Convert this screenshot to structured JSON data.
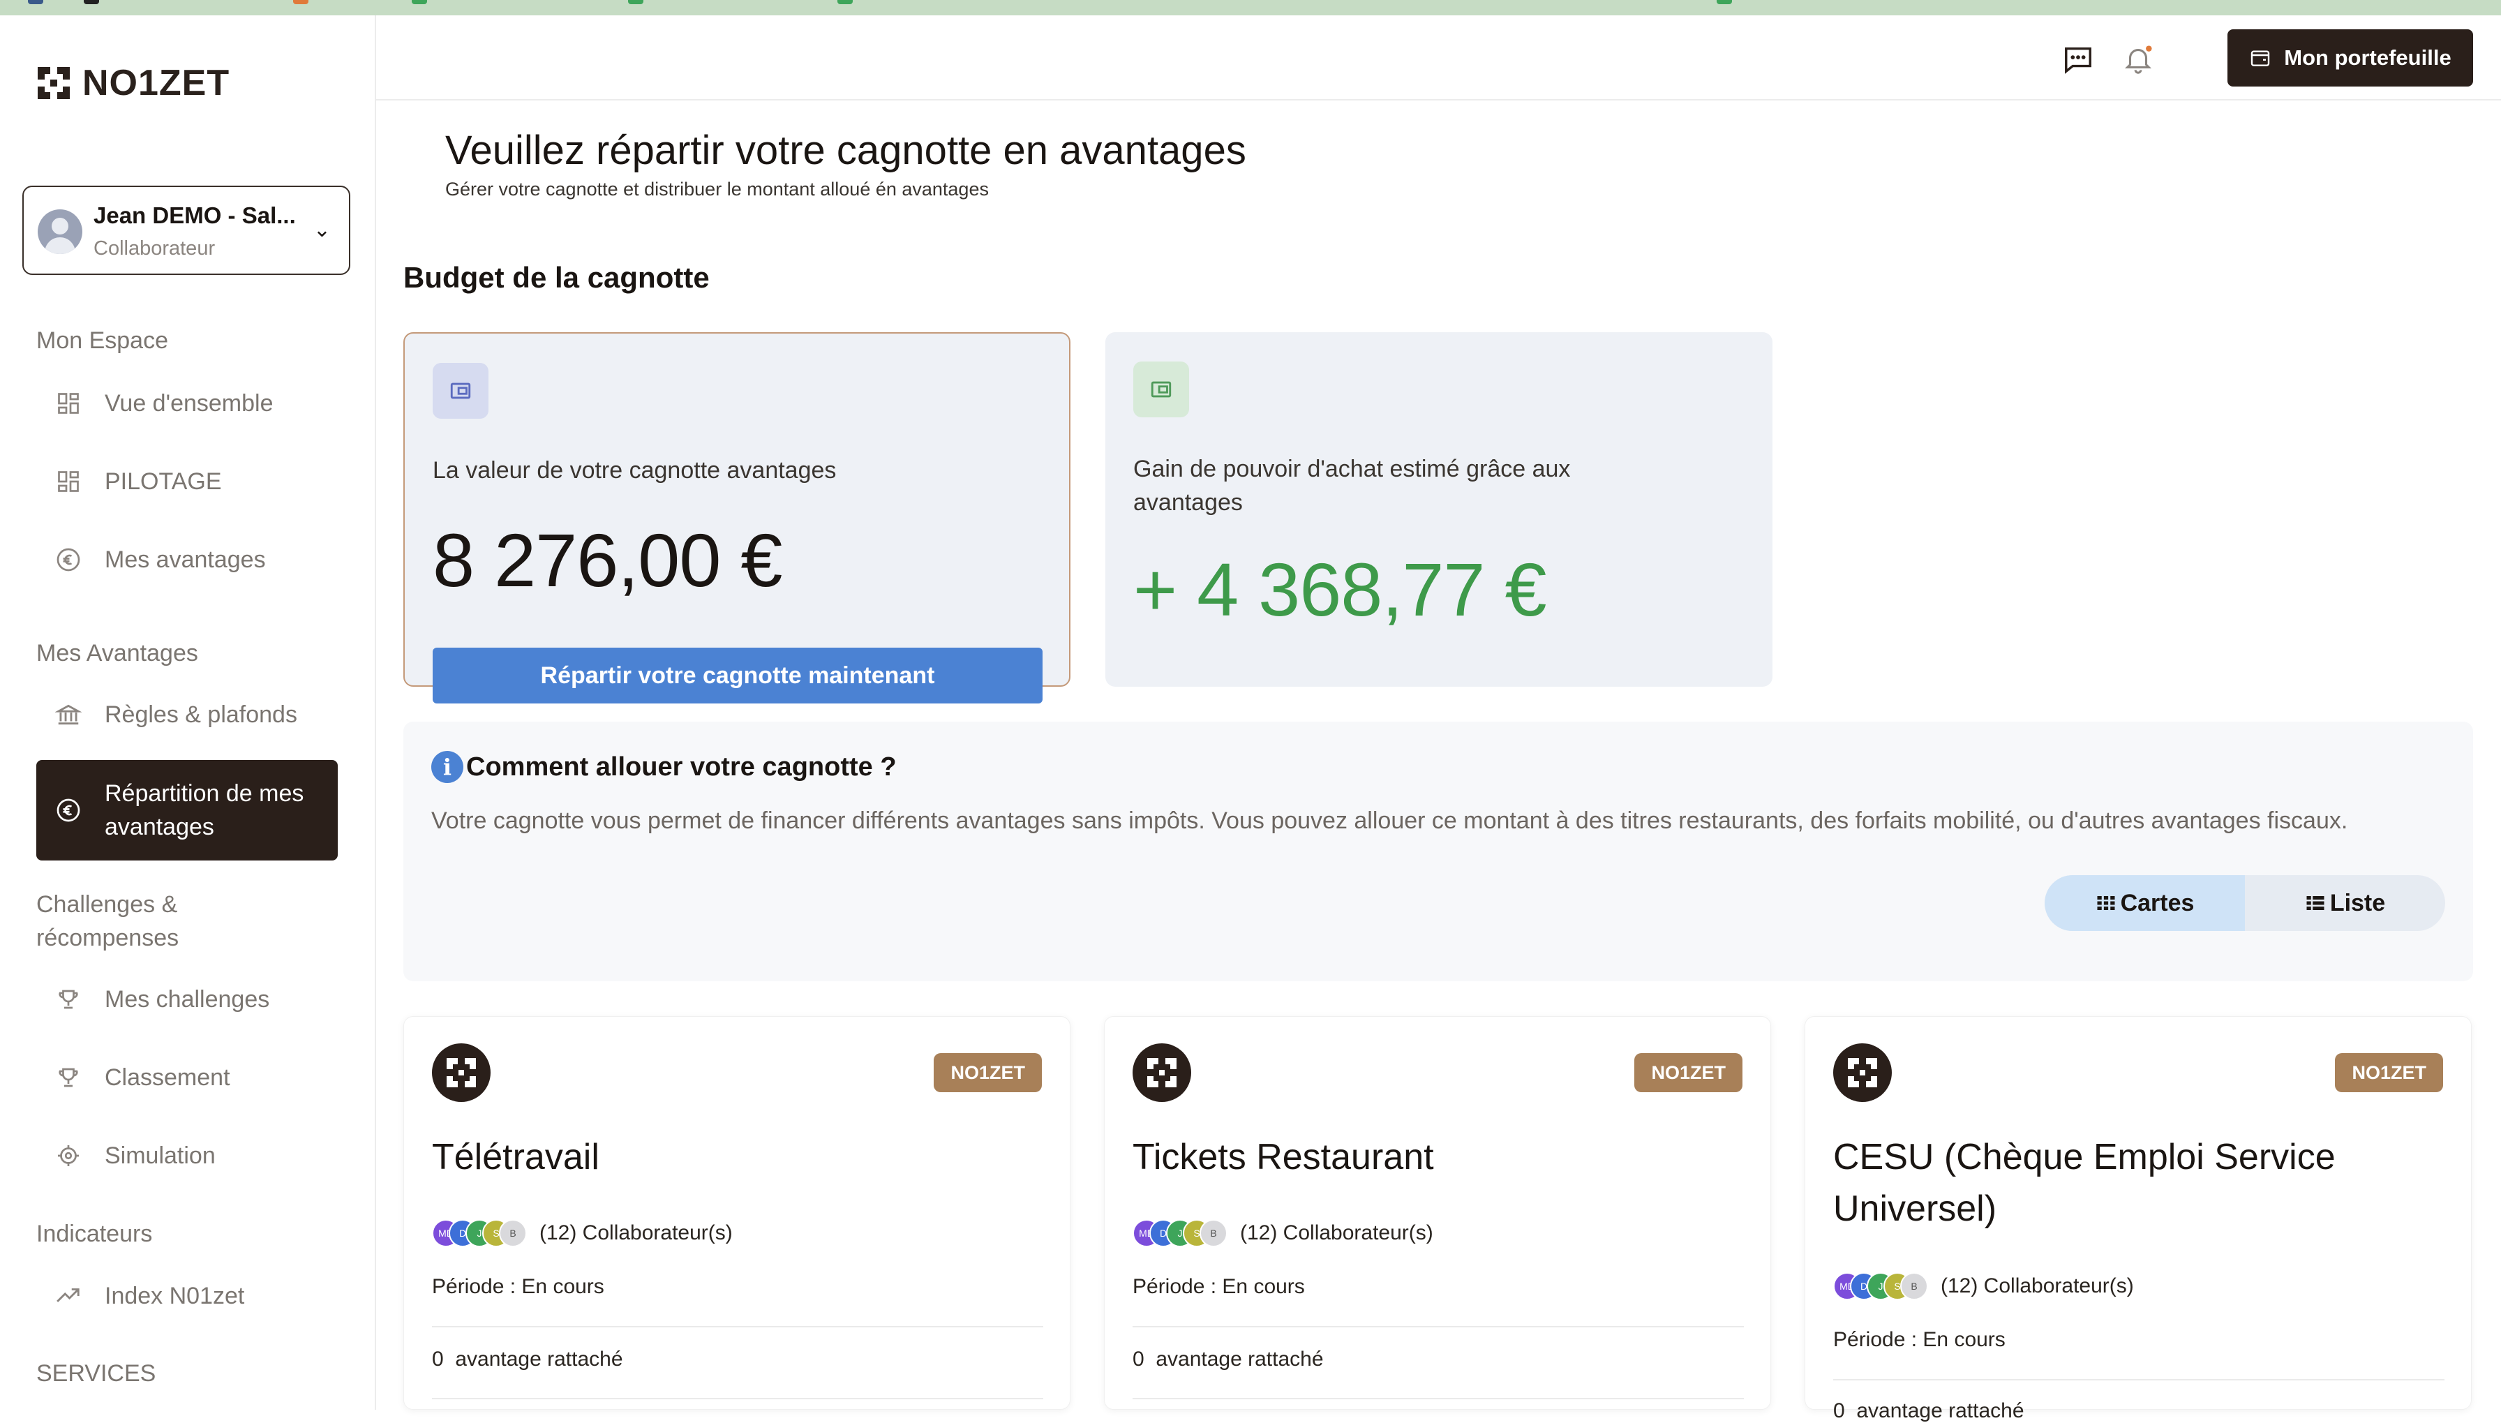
{
  "brand": {
    "name": "NO1ZET",
    "accent": "#2a1f1a",
    "primary_button": "#4b82d3",
    "positive": "#3e9a4a",
    "badge": "#a88058"
  },
  "user": {
    "name": "Jean DEMO - Sal...",
    "role": "Collaborateur"
  },
  "sidebar": {
    "sections": [
      {
        "label": "Mon Espace"
      },
      {
        "label": "Mes Avantages"
      },
      {
        "label": "Challenges & récompenses"
      },
      {
        "label": "Indicateurs"
      },
      {
        "label": "SERVICES"
      }
    ],
    "items": [
      {
        "label": "Vue d'ensemble",
        "icon": "grid-icon"
      },
      {
        "label": "PILOTAGE",
        "icon": "grid-icon"
      },
      {
        "label": "Mes avantages",
        "icon": "euro-icon"
      },
      {
        "label": "Règles & plafonds",
        "icon": "bank-icon"
      },
      {
        "label": "Répartition de mes avantages",
        "icon": "euro-icon",
        "active": true
      },
      {
        "label": "Mes challenges",
        "icon": "trophy-icon"
      },
      {
        "label": "Classement",
        "icon": "trophy-icon"
      },
      {
        "label": "Simulation",
        "icon": "target-icon"
      },
      {
        "label": "Index N01zet",
        "icon": "trend-up-icon"
      }
    ]
  },
  "header": {
    "wallet_button": "Mon portefeuille",
    "icons": [
      "chat-icon",
      "bell-icon"
    ]
  },
  "page": {
    "title": "Veuillez répartir votre cagnotte en avantages",
    "subtitle": "Gérer votre cagnotte et distribuer le montant alloué én avantages",
    "budget_heading": "Budget de la cagnotte"
  },
  "budget": {
    "cagnotte_label": "La valeur de votre cagnotte avantages",
    "cagnotte_value": "8 276,00 €",
    "cta": "Répartir votre cagnotte maintenant",
    "gain_label": "Gain de pouvoir d'achat estimé grâce aux avantages",
    "gain_value": "+ 4 368,77 €"
  },
  "howto": {
    "title": "Comment allouer votre cagnotte ?",
    "body": "Votre cagnotte vous permet de financer différents avantages sans impôts. Vous pouvez allouer ce montant à des titres restaurants, des forfaits mobilité, ou d'autres avantages fiscaux.",
    "view_cards": "Cartes",
    "view_list": "Liste"
  },
  "advantages": [
    {
      "badge": "NO1ZET",
      "title": "Télétravail",
      "collaborators": "(12) Collaborateur(s)",
      "period": "Période : En cours",
      "attached_count": "0",
      "attached_label": "avantage rattaché"
    },
    {
      "badge": "NO1ZET",
      "title": "Tickets Restaurant",
      "collaborators": "(12) Collaborateur(s)",
      "period": "Période : En cours",
      "attached_count": "0",
      "attached_label": "avantage rattaché"
    },
    {
      "badge": "NO1ZET",
      "title": "CESU (Chèque Emploi Service Universel)",
      "collaborators": "(12) Collaborateur(s)",
      "period": "Période : En cours",
      "attached_count": "0",
      "attached_label": "avantage rattaché"
    }
  ],
  "avatars": [
    {
      "initials": "MD",
      "color": "#7c4ddb"
    },
    {
      "initials": "D",
      "color": "#3d6fd8"
    },
    {
      "initials": "J",
      "color": "#3ea55a"
    },
    {
      "initials": "S",
      "color": "#b9b53a"
    },
    {
      "initials": "B",
      "color": "#d9d9dc"
    }
  ]
}
